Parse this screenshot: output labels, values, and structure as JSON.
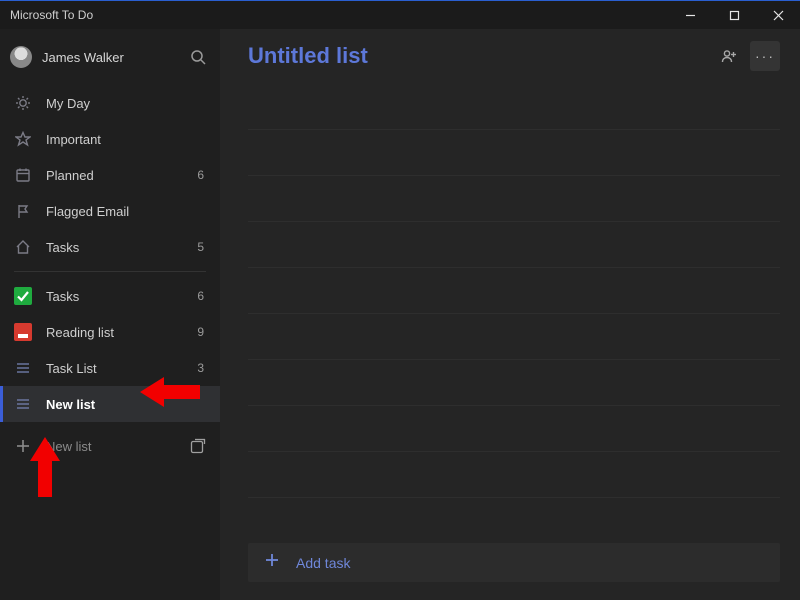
{
  "app": {
    "title": "Microsoft To Do"
  },
  "colors": {
    "accent": "#5d78d9",
    "arrow": "#f20000"
  },
  "user": {
    "name": "James Walker"
  },
  "sidebar": {
    "smart": [
      {
        "icon": "sun",
        "label": "My Day",
        "count": ""
      },
      {
        "icon": "star",
        "label": "Important",
        "count": ""
      },
      {
        "icon": "calendar",
        "label": "Planned",
        "count": "6"
      },
      {
        "icon": "flag",
        "label": "Flagged Email",
        "count": ""
      },
      {
        "icon": "home",
        "label": "Tasks",
        "count": "5"
      }
    ],
    "lists": [
      {
        "icon": "check-green",
        "label": "Tasks",
        "count": "6",
        "selected": false
      },
      {
        "icon": "book-red",
        "label": "Reading list",
        "count": "9",
        "selected": false
      },
      {
        "icon": "list",
        "label": "Task List",
        "count": "3",
        "selected": false
      },
      {
        "icon": "list",
        "label": "New list",
        "count": "",
        "selected": true
      }
    ],
    "newList": {
      "label": "New list"
    }
  },
  "main": {
    "title": "Untitled list",
    "addTask": "Add task",
    "taskRowPlaceholders": 10
  },
  "annotations": {
    "arrow1": {
      "pointsAt": "sidebar-item-new-list"
    },
    "arrow2": {
      "pointsAt": "new-list-button"
    }
  }
}
